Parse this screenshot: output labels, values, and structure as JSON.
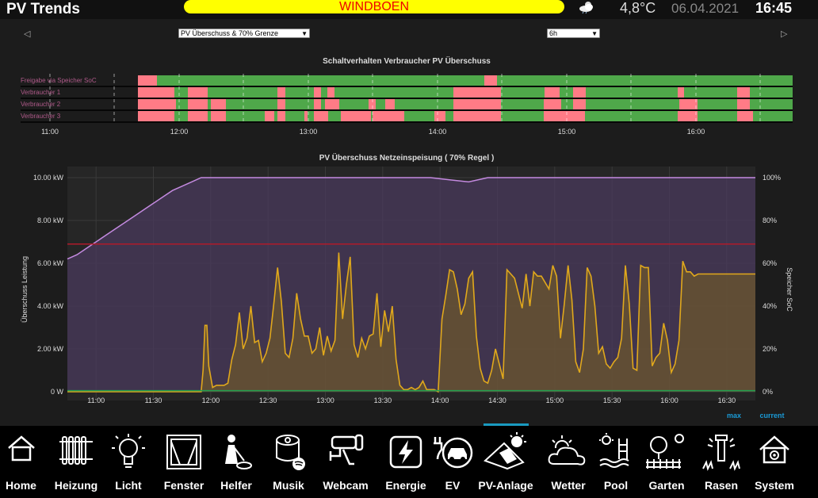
{
  "header": {
    "title": "PV Trends",
    "alert": "WINDBOEN",
    "weather_icon": "cloud-sun-icon",
    "temperature": "4,8°C",
    "date": "06.04.2021",
    "time": "16:45"
  },
  "controls": {
    "prev_icon": "◁",
    "next_icon": "▷",
    "chart_select": "PV Überschuss & 70% Grenze",
    "range_select": "6h"
  },
  "colors": {
    "on": "#4fa84a",
    "off": "#ff7b86",
    "pv": "#d4a017",
    "soc": "#c48ae0",
    "limit": "#b01a2a",
    "grid_line": "#1fa050"
  },
  "status_chart": {
    "title": "Schaltverhalten Verbraucher PV Überschuss",
    "rows": [
      "Freigabe via Speicher SoC",
      "Verbraucher 1",
      "Verbraucher 2",
      "Verbraucher 3"
    ],
    "x_ticks": [
      "11:00",
      "12:00",
      "13:00",
      "14:00",
      "15:00",
      "16:00"
    ]
  },
  "chart_data": {
    "type": "line",
    "title": "PV Überschuss Netzeinspeisung ( 70% Regel )",
    "ylabel": "Überschuss Leistung",
    "y2label": "Speicher SoC",
    "ylim": [
      0,
      10
    ],
    "y2lim": [
      0,
      100
    ],
    "y_ticks": [
      "0 W",
      "2.00 kW",
      "4.00 kW",
      "6.00 kW",
      "8.00 kW",
      "10.00 kW"
    ],
    "y2_ticks": [
      "0%",
      "20%",
      "40%",
      "60%",
      "80%",
      "100%"
    ],
    "x_ticks": [
      "11:00",
      "11:30",
      "12:00",
      "12:30",
      "13:00",
      "13:30",
      "14:00",
      "14:30",
      "15:00",
      "15:30",
      "16:00",
      "16:30"
    ],
    "limit_kw": 6.9,
    "legend": [
      "max",
      "current"
    ],
    "series": [
      {
        "name": "Überschuss Leistung",
        "x_minutes": [
          0,
          70,
          71,
          72,
          73,
          74,
          76,
          78,
          80,
          82,
          84,
          86,
          88,
          90,
          92,
          94,
          96,
          98,
          100,
          102,
          104,
          106,
          108,
          110,
          112,
          114,
          116,
          118,
          120,
          122,
          124,
          126,
          128,
          130,
          132,
          134,
          136,
          138,
          140,
          142,
          144,
          146,
          148,
          150,
          152,
          154,
          156,
          158,
          160,
          162,
          164,
          166,
          168,
          170,
          172,
          174,
          176,
          178,
          180,
          182,
          184,
          186,
          188,
          190,
          192,
          194,
          196,
          198,
          200,
          202,
          204,
          206,
          208,
          210,
          212,
          214,
          216,
          218,
          220,
          222,
          224,
          226,
          228,
          230,
          232,
          234,
          236,
          238,
          240,
          242,
          244,
          246,
          248,
          250,
          252,
          254,
          256,
          258,
          260,
          262,
          264,
          266,
          268,
          270,
          272,
          274,
          276,
          278,
          280,
          282,
          284,
          286,
          288,
          290,
          292,
          294,
          296,
          298,
          300,
          302,
          304,
          306,
          308,
          310,
          312,
          314,
          316,
          318,
          320,
          322,
          324,
          326,
          328,
          330,
          332,
          334,
          336,
          338,
          340,
          342,
          344,
          346,
          348,
          350,
          352,
          354,
          356,
          358,
          360
        ],
        "values": [
          0.0,
          0.0,
          1.0,
          3.1,
          3.1,
          1.2,
          0.2,
          0.3,
          0.3,
          0.3,
          0.4,
          1.5,
          2.2,
          3.7,
          2.0,
          2.5,
          4.0,
          2.3,
          2.4,
          1.4,
          1.8,
          2.5,
          4.1,
          5.8,
          4.2,
          1.8,
          1.6,
          2.5,
          4.6,
          3.4,
          2.6,
          2.6,
          1.8,
          2.0,
          3.0,
          1.7,
          2.6,
          1.9,
          2.4,
          6.5,
          3.4,
          5.0,
          6.3,
          2.2,
          1.6,
          2.5,
          2.0,
          2.6,
          2.7,
          4.6,
          2.1,
          3.8,
          2.8,
          4.0,
          1.5,
          0.3,
          0.1,
          0.1,
          0.2,
          0.1,
          0.2,
          0.5,
          0.1,
          0.1,
          0.1,
          0.0,
          3.4,
          4.5,
          5.7,
          5.6,
          4.8,
          3.6,
          4.1,
          5.3,
          5.6,
          2.6,
          1.1,
          0.5,
          0.4,
          1.0,
          2.0,
          1.3,
          0.6,
          5.7,
          5.5,
          5.3,
          4.6,
          3.9,
          5.5,
          4.0,
          5.6,
          5.4,
          5.4,
          5.1,
          4.8,
          5.9,
          5.4,
          2.5,
          4.1,
          5.9,
          4.3,
          1.4,
          0.9,
          2.0,
          5.8,
          5.4,
          4.0,
          1.8,
          2.1,
          1.3,
          1.1,
          1.4,
          1.6,
          2.5,
          5.9,
          4.1,
          1.1,
          1.0,
          5.9,
          5.8,
          5.8,
          1.2,
          1.6,
          1.8,
          3.2,
          2.4,
          0.9,
          1.3,
          2.4,
          6.1,
          5.6,
          5.6,
          5.4,
          5.5,
          5.5,
          5.5,
          5.5,
          5.5,
          5.5,
          5.5,
          5.5,
          5.5,
          5.5,
          5.5,
          5.5,
          5.5,
          5.5,
          5.5,
          5.5
        ]
      },
      {
        "name": "Speicher SoC",
        "x_minutes": [
          0,
          5,
          10,
          15,
          20,
          25,
          30,
          35,
          40,
          45,
          50,
          55,
          60,
          65,
          70,
          80,
          90,
          100,
          110,
          120,
          130,
          140,
          150,
          160,
          170,
          180,
          190,
          200,
          210,
          220,
          230,
          240,
          250,
          260,
          270,
          280,
          290,
          300,
          310,
          320,
          330,
          340,
          350,
          360
        ],
        "values": [
          62,
          64,
          67,
          70,
          73,
          76,
          79,
          82,
          85,
          88,
          91,
          94,
          96,
          98,
          100,
          100,
          100,
          100,
          100,
          100,
          100,
          100,
          100,
          100,
          100,
          100,
          100,
          99,
          98,
          100,
          100,
          100,
          100,
          100,
          100,
          100,
          100,
          100,
          100,
          100,
          100,
          100,
          100,
          100
        ]
      }
    ]
  },
  "nav": [
    {
      "label": "Home",
      "icon": "home-icon"
    },
    {
      "label": "Heizung",
      "icon": "radiator-icon"
    },
    {
      "label": "Licht",
      "icon": "bulb-icon"
    },
    {
      "label": "Fenster",
      "icon": "window-icon"
    },
    {
      "label": "Helfer",
      "icon": "vacuum-helper-icon"
    },
    {
      "label": "Musik",
      "icon": "speaker-icon"
    },
    {
      "label": "Webcam",
      "icon": "camera-icon"
    },
    {
      "label": "Energie",
      "icon": "energy-icon"
    },
    {
      "label": "EV",
      "icon": "ev-car-icon"
    },
    {
      "label": "PV-Anlage",
      "icon": "solar-panel-icon"
    },
    {
      "label": "Wetter",
      "icon": "weather-icon"
    },
    {
      "label": "Pool",
      "icon": "pool-icon"
    },
    {
      "label": "Garten",
      "icon": "garden-icon"
    },
    {
      "label": "Rasen",
      "icon": "sprinkler-icon"
    },
    {
      "label": "System",
      "icon": "system-home-icon"
    }
  ]
}
